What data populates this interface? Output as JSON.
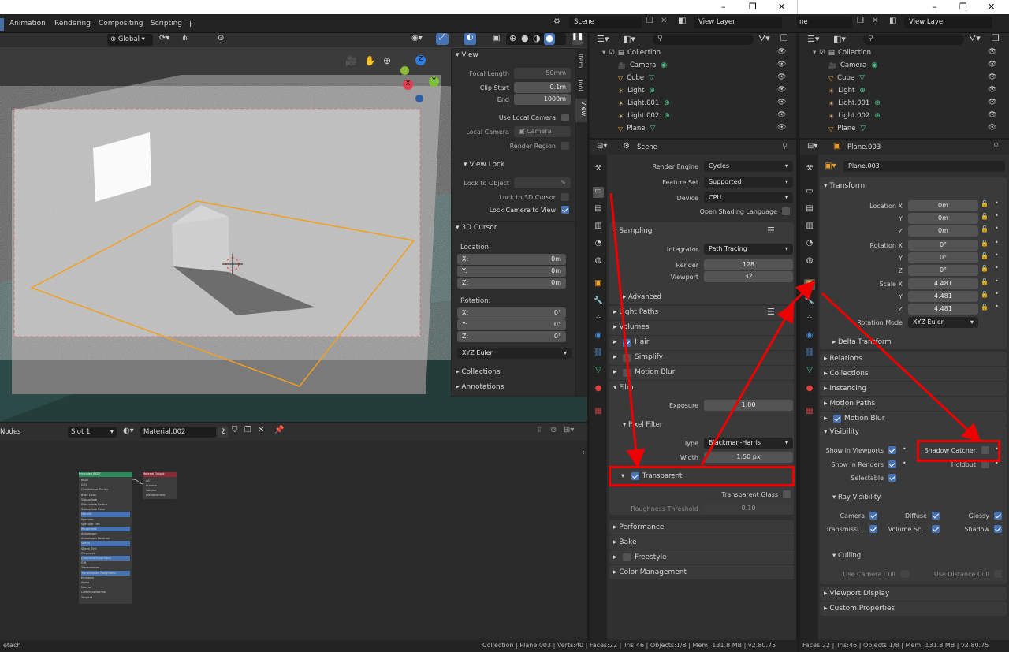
{
  "window": {
    "minimize": "–",
    "maximize": "❐",
    "close": "✕"
  },
  "tabs": [
    "Animation",
    "Rendering",
    "Compositing",
    "Scripting",
    "+"
  ],
  "topbar": {
    "scene_label": "Scene",
    "view_layer_label": "View Layer",
    "partial_scene": "ne",
    "view_layer_label_2": "View Layer"
  },
  "viewport": {
    "orientation": "Global",
    "axis_x": "X",
    "axis_y": "Y",
    "axis_z": "Z"
  },
  "npanel": {
    "tabs": [
      "Item",
      "Tool",
      "View"
    ],
    "view_title": "View",
    "focal_length_label": "Focal Length",
    "focal_length": "50mm",
    "clip_start_label": "Clip Start",
    "clip_start": "0.1m",
    "end_label": "End",
    "end": "1000m",
    "use_local_camera": "Use Local Camera",
    "local_camera_label": "Local Camera",
    "local_camera": "Camera",
    "render_region": "Render Region",
    "view_lock_title": "View Lock",
    "lock_to_object_label": "Lock to Object",
    "lock_to_3d_cursor": "Lock to 3D Cursor",
    "lock_camera_to_view": "Lock Camera to View",
    "cursor_title": "3D Cursor",
    "location_label": "Location:",
    "loc_x_label": "X:",
    "loc_x": "0m",
    "loc_y_label": "Y:",
    "loc_y": "0m",
    "loc_z_label": "Z:",
    "loc_z": "0m",
    "rotation_label": "Rotation:",
    "rot_x_label": "X:",
    "rot_x": "0°",
    "rot_y_label": "Y:",
    "rot_y": "0°",
    "rot_z_label": "Z:",
    "rot_z": "0°",
    "rotation_mode": "XYZ Euler",
    "collections": "Collections",
    "annotations": "Annotations"
  },
  "outliner": {
    "collection": "Collection",
    "items": [
      "Camera",
      "Cube",
      "Light",
      "Light.001",
      "Light.002",
      "Plane",
      "Plane.003"
    ]
  },
  "render_props": {
    "header": "Scene",
    "render_engine_label": "Render Engine",
    "render_engine": "Cycles",
    "feature_set_label": "Feature Set",
    "feature_set": "Supported",
    "device_label": "Device",
    "device": "CPU",
    "osl": "Open Shading Language",
    "sampling": "Sampling",
    "integrator_label": "Integrator",
    "integrator": "Path Tracing",
    "render_label": "Render",
    "render": "128",
    "viewport_label": "Viewport",
    "viewport": "32",
    "advanced": "Advanced",
    "light_paths": "Light Paths",
    "volumes": "Volumes",
    "hair": "Hair",
    "simplify": "Simplify",
    "motion_blur": "Motion Blur",
    "film": "Film",
    "exposure_label": "Exposure",
    "exposure": "1.00",
    "pixel_filter": "Pixel Filter",
    "type_label": "Type",
    "type": "Blackman-Harris",
    "width_label": "Width",
    "width": "1.50 px",
    "transparent": "Transparent",
    "transparent_glass": "Transparent Glass",
    "roughness_threshold_label": "Roughness Threshold",
    "roughness_threshold": "0.10",
    "performance": "Performance",
    "bake": "Bake",
    "freestyle": "Freestyle",
    "color_management": "Color Management"
  },
  "object_props": {
    "header": "Plane.003",
    "object_name": "Plane.003",
    "transform": "Transform",
    "location_x_label": "Location X",
    "location_x": "0m",
    "y_label": "Y",
    "location_y": "0m",
    "z_label": "Z",
    "location_z": "0m",
    "rotation_x_label": "Rotation X",
    "rotation_x": "0°",
    "rotation_y": "0°",
    "rotation_z": "0°",
    "scale_x_label": "Scale X",
    "scale_x": "4.481",
    "scale_y": "4.481",
    "scale_z": "4.481",
    "rotation_mode_label": "Rotation Mode",
    "rotation_mode": "XYZ Euler",
    "delta_transform": "Delta Transform",
    "relations": "Relations",
    "collections": "Collections",
    "instancing": "Instancing",
    "motion_paths": "Motion Paths",
    "motion_blur": "Motion Blur",
    "visibility": "Visibility",
    "show_in_viewports": "Show in Viewports",
    "shadow_catcher": "Shadow Catcher",
    "show_in_renders": "Show in Renders",
    "holdout": "Holdout",
    "selectable": "Selectable",
    "ray_visibility": "Ray Visibility",
    "camera": "Camera",
    "diffuse": "Diffuse",
    "glossy": "Glossy",
    "transmission": "Transmissi...",
    "volume_scatter": "Volume Sc...",
    "shadow": "Shadow",
    "culling": "Culling",
    "use_camera_cull": "Use Camera Cull",
    "use_distance_cull": "Use Distance Cull",
    "viewport_display": "Viewport Display",
    "custom_properties": "Custom Properties"
  },
  "node_editor": {
    "label": "Nodes",
    "slot": "Slot 1",
    "material": "Material.002",
    "users": "2",
    "bsdf_title": "Principled BSDF",
    "output_title": "Material Output",
    "bsdf_rows": [
      "BSDF",
      "GGX",
      "Christensen-Burley",
      "Base Color",
      "Subsurface",
      "Subsurface Radius",
      "Subsurface Color",
      "Metallic",
      "Specular",
      "Specular Tint",
      "Roughness",
      "Anisotropic",
      "Anisotropic Rotation",
      "Sheen",
      "Sheen Tint",
      "Clearcoat",
      "Clearcoat Roughness",
      "IOR",
      "Transmission",
      "Transmission Roughness",
      "Emission",
      "Alpha",
      "Normal",
      "Clearcoat Normal",
      "Tangent"
    ],
    "output_rows": [
      "All",
      "Surface",
      "Volume",
      "Displacement"
    ]
  },
  "status": {
    "left": "etach",
    "center": "Collection | Plane.003 | Verts:40 | Faces:22 | Tris:46 | Objects:1/8 | Mem: 131.8 MB | v2.80.75",
    "right": "Faces:22 | Tris:46 | Objects:1/8 | Mem: 131.8 MB | v2.80.75"
  },
  "colors": {
    "accent": "#4772b3",
    "highlight": "#ee0000",
    "selection": "#f0a020"
  }
}
